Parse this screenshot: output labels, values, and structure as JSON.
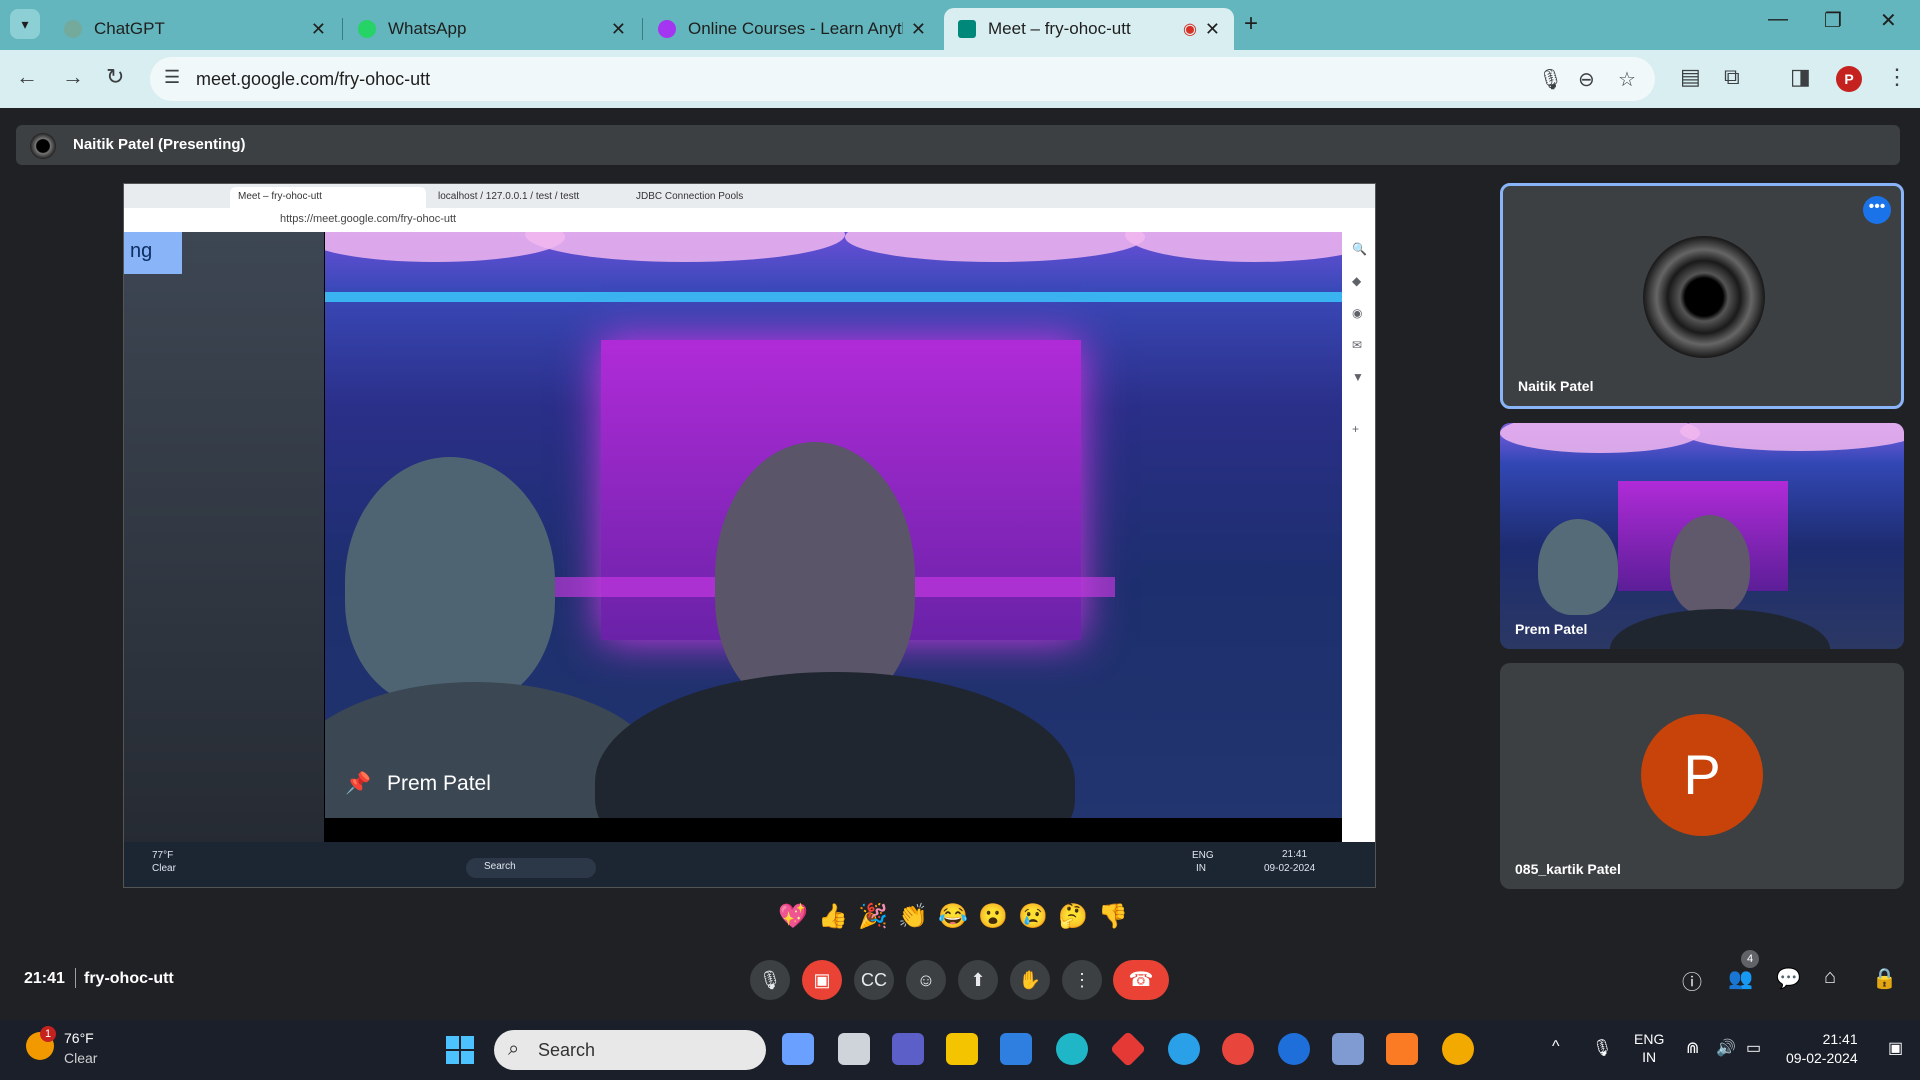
{
  "browser": {
    "tabs": [
      {
        "label": "ChatGPT",
        "color": "#74aa9c"
      },
      {
        "label": "WhatsApp",
        "color": "#25d366"
      },
      {
        "label": "Online Courses - Learn Anything",
        "color": "#a435f0"
      },
      {
        "label": "Meet – fry-ohoc-utt",
        "color": "#00897b"
      }
    ],
    "url": "meet.google.com/fry-ohoc-utt",
    "profile_initial": "P"
  },
  "meet": {
    "presenter_title": "Naitik Patel (Presenting)",
    "time": "21:41",
    "meeting_code": "fry-ohoc-utt",
    "participants_count": "4",
    "reactions": [
      "💖",
      "👍",
      "🎉",
      "👏",
      "😂",
      "😮",
      "😢",
      "🤔",
      "👎"
    ]
  },
  "shared": {
    "tabs": [
      "Meet – fry-ohoc-utt",
      "localhost / 127.0.0.1 / test / testt",
      "JDBC Connection Pools"
    ],
    "url": "https://meet.google.com/fry-ohoc-utt",
    "side_badge": "ng",
    "pinned_name": "Prem Patel",
    "taskbar": {
      "temp": "77°F",
      "cond": "Clear",
      "search": "Search",
      "lang1": "ENG",
      "lang2": "IN",
      "time": "21:41",
      "date": "09-02-2024"
    }
  },
  "tiles": [
    {
      "name": "Naitik Patel"
    },
    {
      "name": "Prem Patel"
    },
    {
      "name": "085_kartik Patel",
      "initial": "P"
    }
  ],
  "taskbar": {
    "temp": "76°F",
    "cond": "Clear",
    "badge": "1",
    "search": "Search",
    "lang1": "ENG",
    "lang2": "IN",
    "time": "21:41",
    "date": "09-02-2024"
  }
}
